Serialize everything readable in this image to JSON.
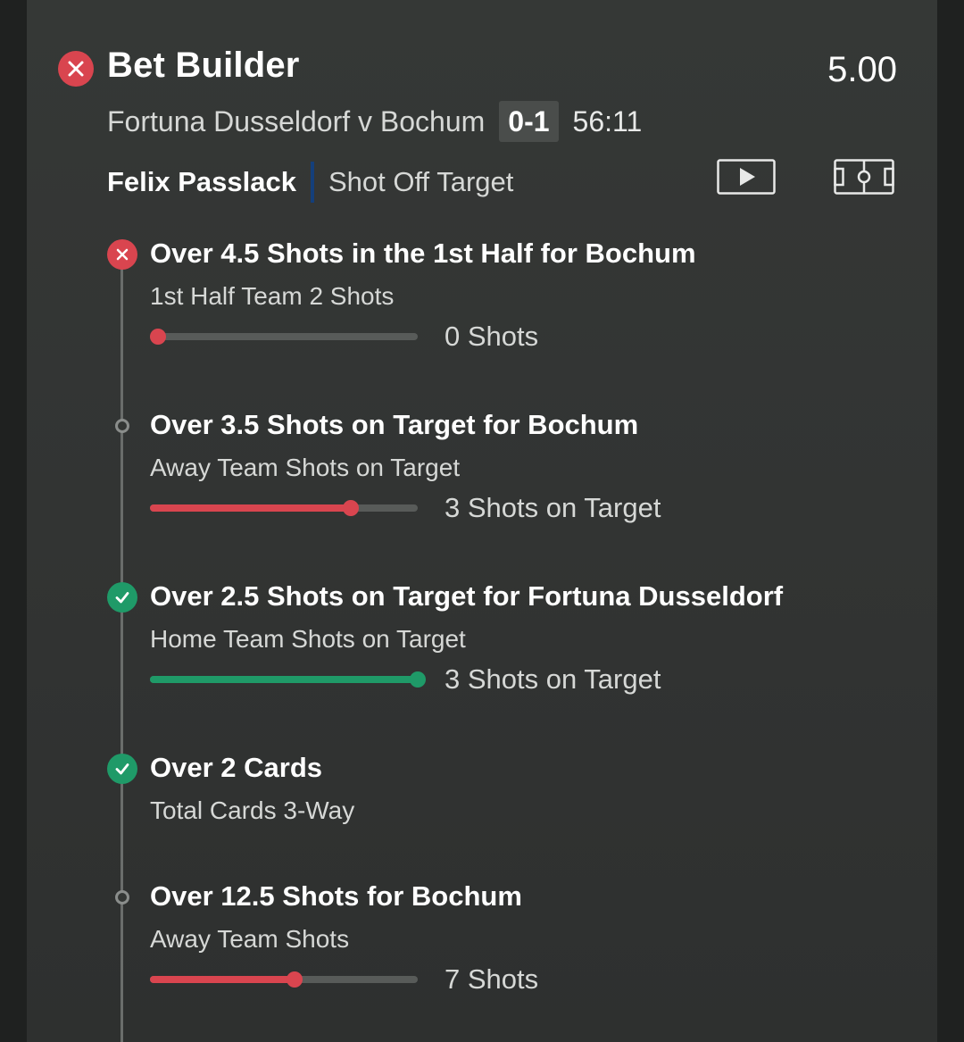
{
  "colors": {
    "lost": "#d9454f",
    "won": "#1f9a68",
    "track": "#585b59",
    "background": "#333634"
  },
  "header": {
    "status_icon": "close-x-icon",
    "title": "Bet Builder",
    "odds": "5.00"
  },
  "match": {
    "teams": "Fortuna Dusseldorf v Bochum",
    "score": "0-1",
    "time": "56:11"
  },
  "event": {
    "player": "Felix Passlack",
    "type": "Shot Off Target",
    "icons": [
      "play-video-icon",
      "pitch-view-icon"
    ]
  },
  "legs": [
    {
      "status": "lost",
      "title": "Over 4.5 Shots in the 1st Half for Bochum",
      "market": "1st Half Team 2 Shots",
      "progress": 0.0,
      "progress_text": "0 Shots"
    },
    {
      "status": "open",
      "title": "Over 3.5 Shots on Target for Bochum",
      "market": "Away Team Shots on Target",
      "progress": 0.75,
      "progress_text": "3 Shots on Target"
    },
    {
      "status": "won",
      "title": "Over 2.5 Shots on Target for Fortuna Dusseldorf",
      "market": "Home Team Shots on Target",
      "progress": 1.0,
      "progress_text": "3 Shots on Target"
    },
    {
      "status": "won",
      "title": "Over 2 Cards",
      "market": "Total Cards 3-Way"
    },
    {
      "status": "open",
      "title": "Over 12.5 Shots for Bochum",
      "market": "Away Team Shots",
      "progress": 0.54,
      "progress_text": "7 Shots"
    }
  ]
}
